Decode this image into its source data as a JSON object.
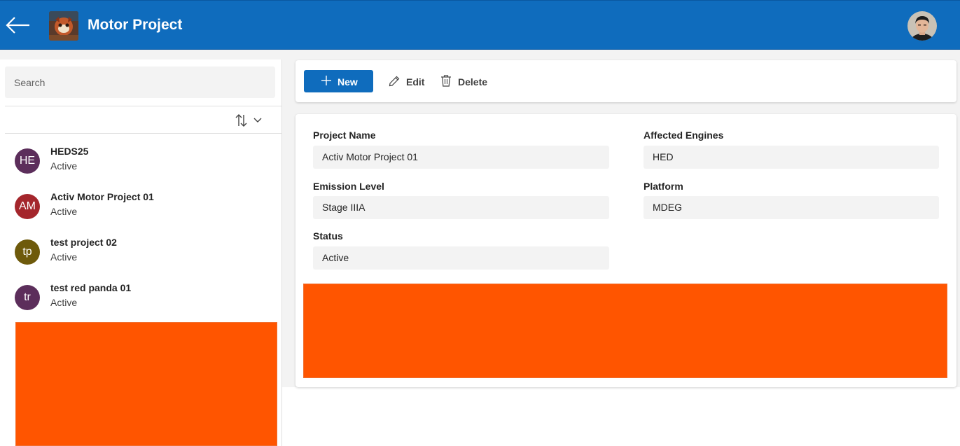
{
  "header": {
    "title": "Motor Project",
    "accent_color": "#0f6cbd",
    "back_icon": "arrow-left-icon",
    "logo": "red-panda-logo",
    "user_avatar": "user-photo-avatar"
  },
  "sidebar": {
    "search_placeholder": "Search",
    "sort_icon": "sort-arrows-icon",
    "items": [
      {
        "initials": "HE",
        "title": "HEDS25",
        "status": "Active",
        "color": "#5c2e5b"
      },
      {
        "initials": "AM",
        "title": "Activ Motor Project 01",
        "status": "Active",
        "color": "#a4262c"
      },
      {
        "initials": "tp",
        "title": "test project 02",
        "status": "Active",
        "color": "#6e5a0b"
      },
      {
        "initials": "tr",
        "title": "test red panda 01",
        "status": "Active",
        "color": "#5c2e5b"
      }
    ]
  },
  "toolbar": {
    "new_label": "New",
    "edit_label": "Edit",
    "delete_label": "Delete"
  },
  "form": {
    "project_name_label": "Project Name",
    "project_name_value": "Activ Motor Project 01",
    "affected_engines_label": "Affected Engines",
    "affected_engines_value": "HED",
    "emission_level_label": "Emission Level",
    "emission_level_value": "Stage IIIA",
    "platform_label": "Platform",
    "platform_value": "MDEG",
    "status_label": "Status",
    "status_value": "Active"
  },
  "redaction_color": "#ff5500"
}
